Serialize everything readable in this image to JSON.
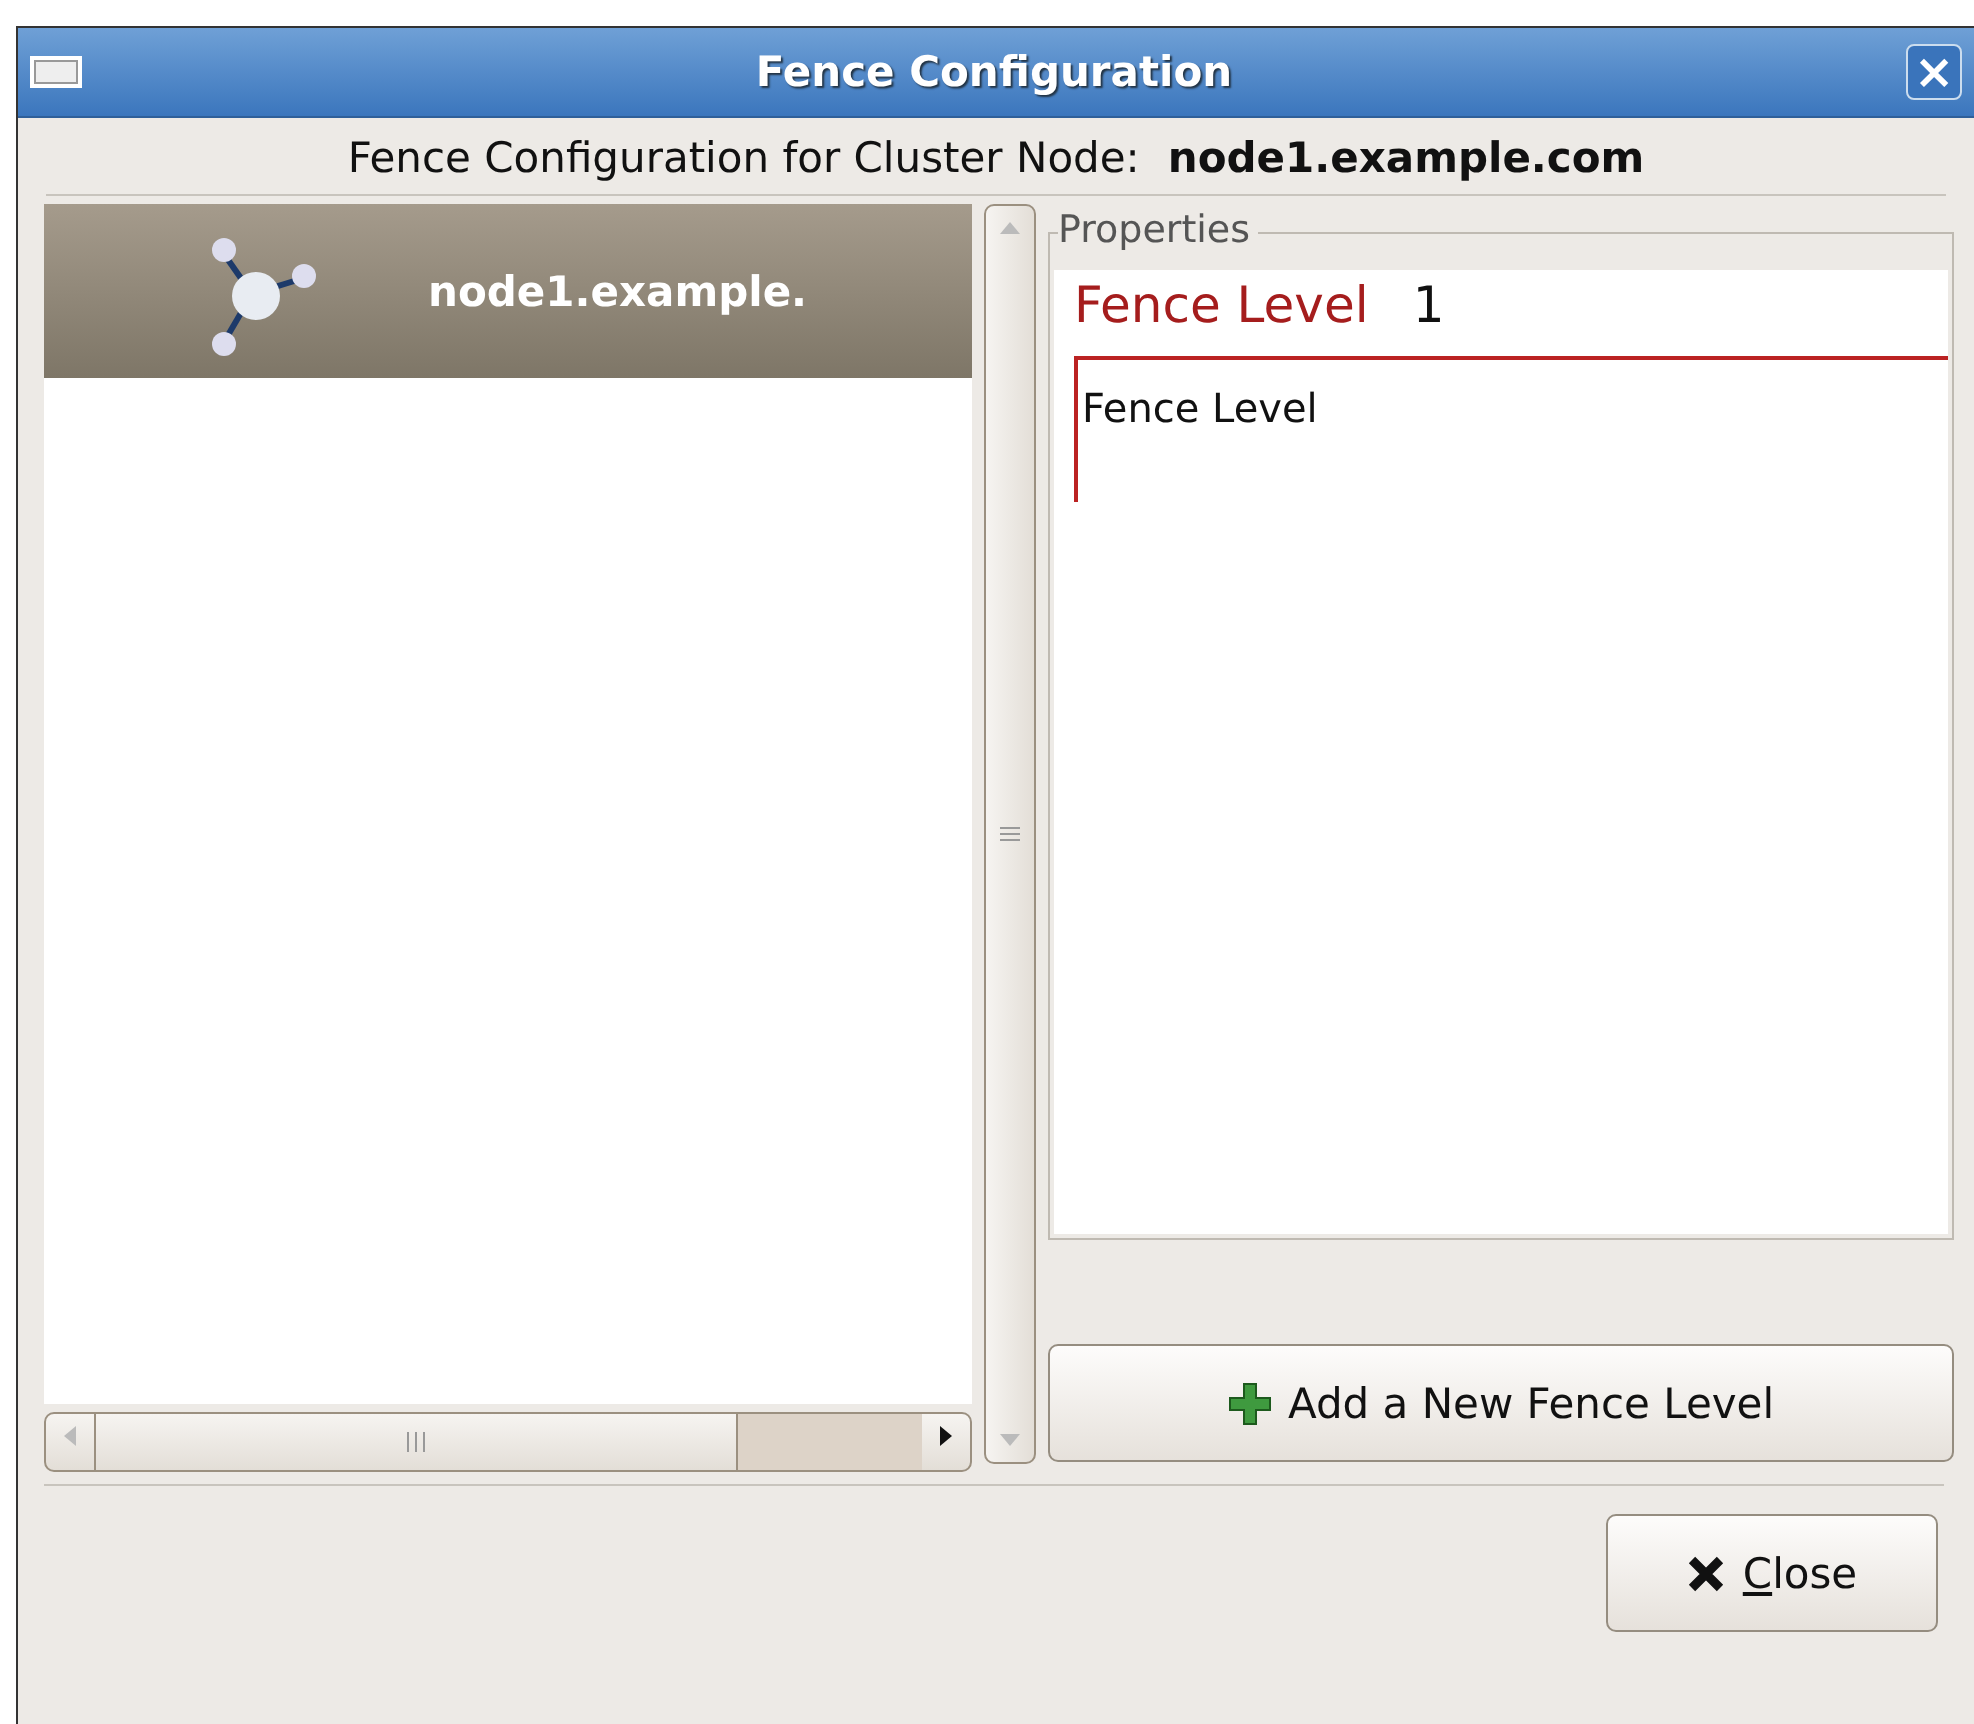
{
  "window": {
    "title": "Fence Configuration",
    "close_glyph": "×"
  },
  "header": {
    "label": "Fence Configuration for Cluster Node:",
    "node": "node1.example.com"
  },
  "tree": {
    "items": [
      {
        "label": "node1.example.",
        "selected": true
      }
    ]
  },
  "properties": {
    "title": "Properties",
    "heading_label": "Fence Level",
    "heading_value": "1",
    "section_label": "Fence Level"
  },
  "buttons": [
    {
      "kind": "add",
      "label": "Add a New Fence Level"
    },
    {
      "kind": "close",
      "label": "Close"
    }
  ]
}
